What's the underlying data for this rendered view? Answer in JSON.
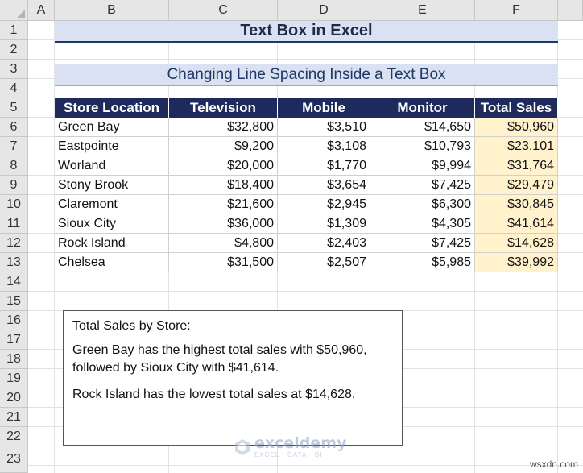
{
  "columns": [
    "A",
    "B",
    "C",
    "D",
    "E",
    "F"
  ],
  "rows": [
    "1",
    "2",
    "3",
    "4",
    "5",
    "6",
    "7",
    "8",
    "9",
    "10",
    "11",
    "12",
    "13",
    "14",
    "15",
    "16",
    "17",
    "18",
    "19",
    "20",
    "21",
    "22",
    "23"
  ],
  "title": "Text Box in Excel",
  "subtitle": "Changing Line Spacing Inside a Text Box",
  "table": {
    "headers": [
      "Store Location",
      "Television",
      "Mobile",
      "Monitor",
      "Total Sales"
    ],
    "rows": [
      [
        "Green Bay",
        "$32,800",
        "$3,510",
        "$14,650",
        "$50,960"
      ],
      [
        "Eastpointe",
        "$9,200",
        "$3,108",
        "$10,793",
        "$23,101"
      ],
      [
        "Worland",
        "$20,000",
        "$1,770",
        "$9,994",
        "$31,764"
      ],
      [
        "Stony Brook",
        "$18,400",
        "$3,654",
        "$7,425",
        "$29,479"
      ],
      [
        "Claremont",
        "$21,600",
        "$2,945",
        "$6,300",
        "$30,845"
      ],
      [
        "Sioux City",
        "$36,000",
        "$1,309",
        "$4,305",
        "$41,614"
      ],
      [
        "Rock Island",
        "$4,800",
        "$2,403",
        "$7,425",
        "$14,628"
      ],
      [
        "Chelsea",
        "$31,500",
        "$2,507",
        "$5,985",
        "$39,992"
      ]
    ]
  },
  "textbox": {
    "line1": "Total Sales by Store:",
    "line2": "Green Bay has the highest total sales with $50,960, followed by Sioux City with $41,614.",
    "line3": "Rock Island has the lowest total sales at $14,628."
  },
  "watermark": {
    "name": "exceldemy",
    "tagline": "EXCEL · DATA · BI",
    "icon": "exceldemy-logo-icon"
  },
  "site_label": "wsxdn.com",
  "colors": {
    "header_fill": "#1f2a5c",
    "title_fill": "#d9e1f2",
    "total_fill": "#fff2cc"
  }
}
